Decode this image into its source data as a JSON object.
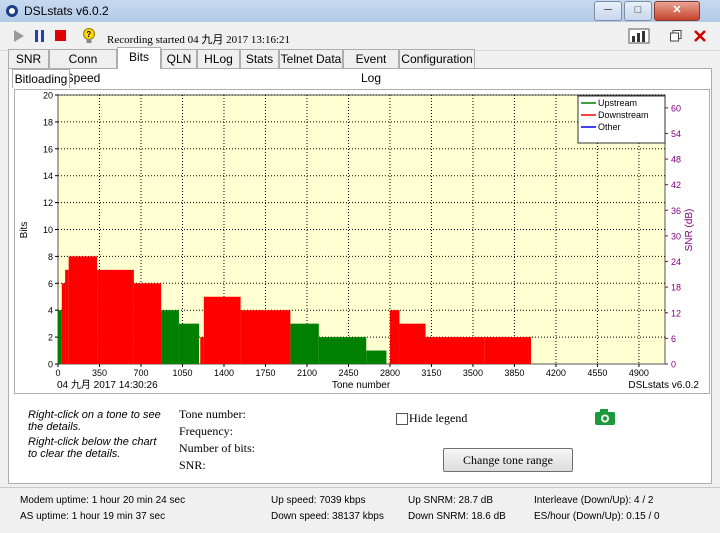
{
  "window": {
    "title": "DSLstats v6.0.2",
    "minimize": "─",
    "maximize": "□",
    "close": "✕"
  },
  "toolbar": {
    "recording_text": "Recording started 04 九月 2017 13:16:21"
  },
  "tabs": [
    {
      "label": "SNR"
    },
    {
      "label": "Conn Speed"
    },
    {
      "label": "Bits"
    },
    {
      "label": "QLN"
    },
    {
      "label": "HLog"
    },
    {
      "label": "Stats"
    },
    {
      "label": "Telnet Data"
    },
    {
      "label": "Event Log"
    },
    {
      "label": "Configuration"
    }
  ],
  "active_tab": "Bits",
  "subtab": {
    "label": "Bitloading"
  },
  "chart_data": {
    "type": "bar",
    "ylabel": "Bits",
    "y2label": "SNR (dB)",
    "xlabel": "Tone number",
    "xlim": [
      0,
      5120
    ],
    "ylim": [
      0,
      20
    ],
    "y2lim": [
      0,
      63
    ],
    "x_ticks": [
      0,
      350,
      700,
      1050,
      1400,
      1750,
      2100,
      2450,
      2800,
      3150,
      3500,
      3850,
      4200,
      4550,
      4900
    ],
    "y_ticks": [
      0,
      2,
      4,
      6,
      8,
      10,
      12,
      14,
      16,
      18,
      20
    ],
    "y2_ticks": [
      0,
      6,
      12,
      18,
      24,
      30,
      36,
      42,
      48,
      54,
      60
    ],
    "date_label": "04 九月 2017 14:30:26",
    "version_label": "DSLstats v6.0.2",
    "grid": true,
    "legend_position": "top-right",
    "legend": [
      {
        "name": "Upstream",
        "color": "#008000"
      },
      {
        "name": "Downstream",
        "color": "#ff0000"
      },
      {
        "name": "Other",
        "color": "#0000ff"
      }
    ],
    "series": [
      {
        "name": "Upstream",
        "color": "#008000",
        "segments": [
          {
            "x0": 0,
            "x1": 32,
            "value": 4
          },
          {
            "x0": 870,
            "x1": 1020,
            "value": 4
          },
          {
            "x0": 1020,
            "x1": 1190,
            "value": 3
          },
          {
            "x0": 1960,
            "x1": 2200,
            "value": 3
          },
          {
            "x0": 2200,
            "x1": 2600,
            "value": 2
          },
          {
            "x0": 2600,
            "x1": 2770,
            "value": 1
          }
        ]
      },
      {
        "name": "Downstream",
        "color": "#ff0000",
        "segments": [
          {
            "x0": 32,
            "x1": 60,
            "value": 6
          },
          {
            "x0": 60,
            "x1": 90,
            "value": 7
          },
          {
            "x0": 90,
            "x1": 330,
            "value": 8
          },
          {
            "x0": 330,
            "x1": 640,
            "value": 7
          },
          {
            "x0": 640,
            "x1": 870,
            "value": 6
          },
          {
            "x0": 1200,
            "x1": 1230,
            "value": 2
          },
          {
            "x0": 1230,
            "x1": 1540,
            "value": 5
          },
          {
            "x0": 1540,
            "x1": 1960,
            "value": 4
          },
          {
            "x0": 2800,
            "x1": 2880,
            "value": 4
          },
          {
            "x0": 2880,
            "x1": 3100,
            "value": 3
          },
          {
            "x0": 3100,
            "x1": 3600,
            "value": 2
          },
          {
            "x0": 3600,
            "x1": 3990,
            "value": 2
          }
        ]
      }
    ]
  },
  "info": {
    "hint1": "Right-click on a tone to see the details.",
    "hint2": "Right-click below the chart to clear the details.",
    "tone_number_label": "Tone number:",
    "frequency_label": "Frequency:",
    "number_of_bits_label": "Number of bits:",
    "snr_label": "SNR:",
    "hide_legend_label": "Hide legend",
    "change_tone_range_label": "Change tone range"
  },
  "status": {
    "modem_uptime": "Modem uptime:  1 hour 20 min 24 sec",
    "as_uptime": "AS uptime:  1 hour 19 min 37 sec",
    "up_speed": "Up speed: 7039 kbps",
    "down_speed": "Down speed: 38137 kbps",
    "up_snrm": "Up SNRM: 28.7 dB",
    "down_snrm": "Down SNRM: 18.6 dB",
    "interleave": "Interleave (Down/Up): 4 / 2",
    "es_hour": "ES/hour (Down/Up): 0.15 / 0"
  }
}
